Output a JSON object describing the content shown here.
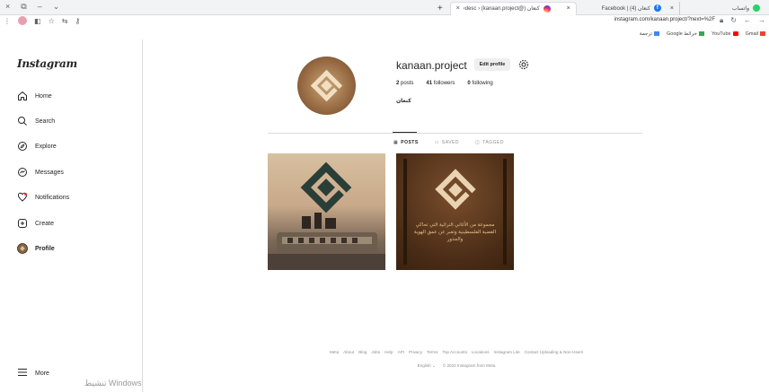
{
  "browser": {
    "window_controls": [
      "×",
      "⧉",
      "–",
      "⌄"
    ],
    "tabs": [
      {
        "label": "‹desc › (kanaan.project@) كنعان",
        "favicon": "instagram-favicon",
        "active": true
      },
      {
        "label": "Facebook | كنعان (4)",
        "favicon": "facebook-favicon",
        "active": false
      },
      {
        "label": "واتساب",
        "favicon": "whatsapp-favicon",
        "active": false
      }
    ],
    "url": "instagram.com/kanaan.project/?next=%2F",
    "bookmarks": [
      {
        "label": "ترجمة",
        "color": "#4285f4"
      },
      {
        "label": "Google خرائط",
        "color": "#34a853"
      },
      {
        "label": "YouTube",
        "color": "#ff0000"
      },
      {
        "label": "Gmail",
        "color": "#ea4335"
      }
    ]
  },
  "sidebar": {
    "logo": "Instagram",
    "items": [
      {
        "label": "Home",
        "icon": "home-icon"
      },
      {
        "label": "Search",
        "icon": "search-icon"
      },
      {
        "label": "Explore",
        "icon": "explore-icon"
      },
      {
        "label": "Messages",
        "icon": "messages-icon"
      },
      {
        "label": "Notifications",
        "icon": "heart-icon"
      },
      {
        "label": "Create",
        "icon": "create-icon"
      },
      {
        "label": "Profile",
        "icon": "profile-avatar-icon"
      }
    ],
    "more_label": "More"
  },
  "watermark": "تنشيط Windows",
  "profile": {
    "username": "kanaan.project",
    "edit_label": "Edit profile",
    "posts_count": "2",
    "posts_label": "posts",
    "followers_count": "41",
    "followers_label": "followers",
    "following_count": "0",
    "following_label": "following",
    "full_name": "كنعان"
  },
  "profile_tabs": {
    "posts": "POSTS",
    "saved": "SAVED",
    "tagged": "TAGGED"
  },
  "post2_caption": "مجموعة من الأغاني التراثية التي تحاكي القضية الفلسطينية وتعبر عن عمق الهوية والجذور",
  "footer": {
    "links": [
      "Meta",
      "About",
      "Blog",
      "Jobs",
      "Help",
      "API",
      "Privacy",
      "Terms",
      "Top Accounts",
      "Locations",
      "Instagram Lite",
      "Contact Uploading & Non-Users"
    ],
    "language": "English",
    "copyright": "© 2022 Instagram from Meta"
  }
}
